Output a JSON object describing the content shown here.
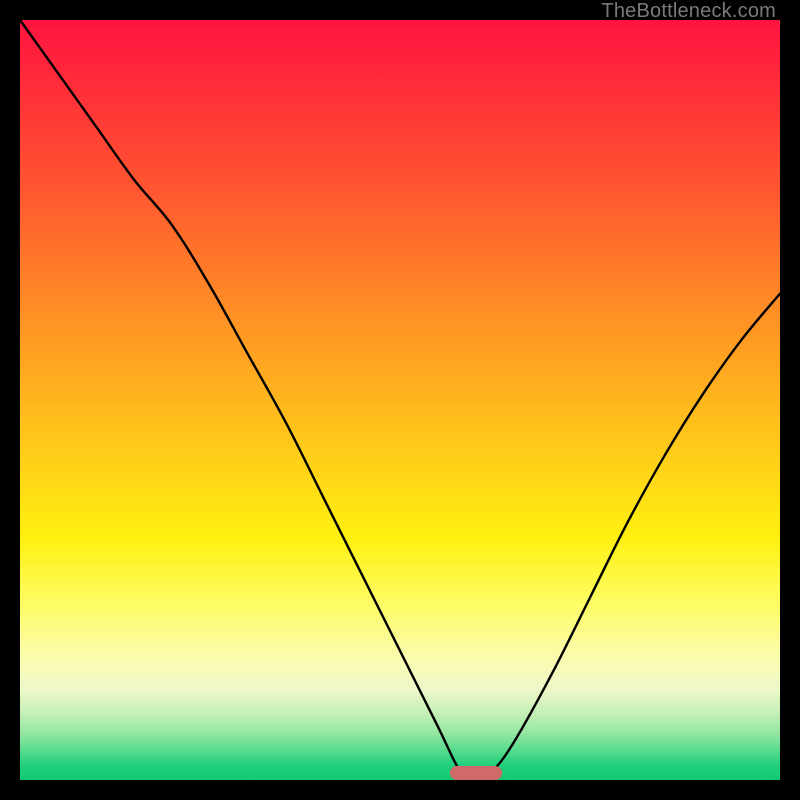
{
  "watermark": "TheBottleneck.com",
  "colors": {
    "frame": "#000000",
    "curve": "#000000",
    "marker": "#d06a6a",
    "gradient_stops": [
      "#ff1440",
      "#ff5530",
      "#ffa820",
      "#fff010",
      "#fbfbb0",
      "#4cd98a",
      "#12c974"
    ]
  },
  "chart_data": {
    "type": "line",
    "title": "",
    "xlabel": "",
    "ylabel": "",
    "xlim": [
      0,
      100
    ],
    "ylim": [
      0,
      100
    ],
    "grid": false,
    "legend": false,
    "note": "Values estimated from pixel positions; y=100 at top, y=0 at bottom.",
    "x": [
      0,
      5,
      10,
      15,
      20,
      25,
      30,
      35,
      40,
      45,
      50,
      55,
      58,
      60,
      62,
      65,
      70,
      75,
      80,
      85,
      90,
      95,
      100
    ],
    "y": [
      100,
      93,
      86,
      79,
      73,
      65,
      56,
      47,
      37,
      27,
      17,
      7,
      1,
      0,
      1,
      5,
      14,
      24,
      34,
      43,
      51,
      58,
      64
    ],
    "minimum_marker": {
      "x": 60,
      "y": 0,
      "shape": "pill"
    }
  }
}
